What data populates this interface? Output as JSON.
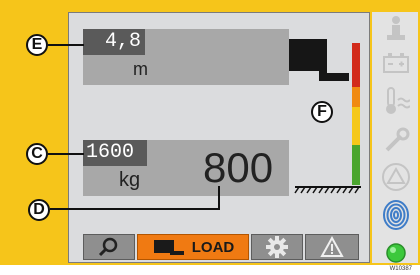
{
  "callouts": {
    "e": "E",
    "c": "C",
    "d": "D",
    "f": "F"
  },
  "height_readout": {
    "value": "4,8",
    "unit": "m"
  },
  "load_readout": {
    "capacity": "1600",
    "unit": "kg",
    "actual": "800"
  },
  "bottom_bar": {
    "load_label": "LOAD"
  },
  "sidebar_icons": [
    "person-lift-icon",
    "battery-icon",
    "temperature-icon",
    "wrench-icon",
    "warning-triangle-icon",
    "fingerprint-icon",
    "green-status-led"
  ],
  "colors": {
    "bezel": "#f6c51a",
    "screen": "#dbdcde",
    "active_button": "#f07a12",
    "gauge_red": "#d22a1a",
    "gauge_orange": "#f08a12",
    "gauge_yellow": "#f5c81a",
    "gauge_green": "#4aa52e",
    "status_led": "#3cc83c"
  },
  "figure_code": "W10387"
}
